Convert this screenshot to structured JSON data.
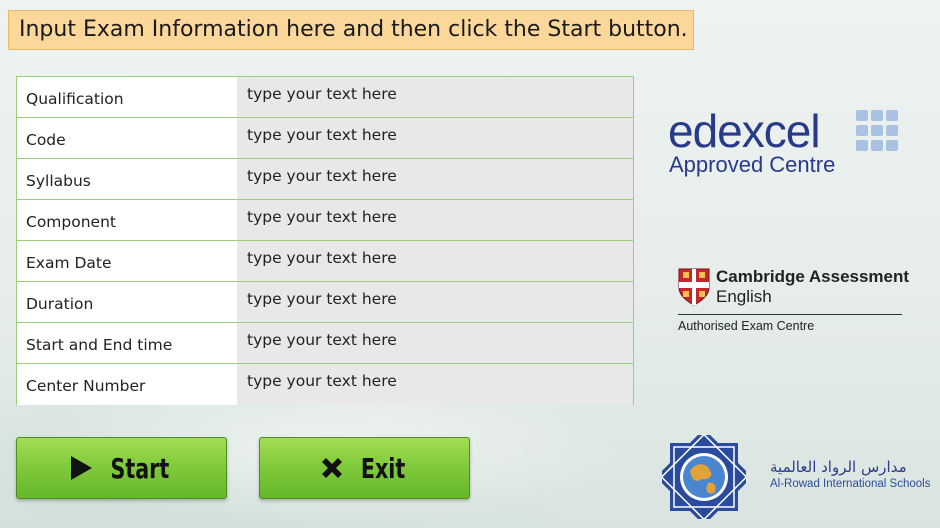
{
  "banner": {
    "text": "Input Exam Information here and then click the Start button."
  },
  "form": {
    "rows": [
      {
        "label": "Qualification",
        "placeholder": "type your text here"
      },
      {
        "label": "Code",
        "placeholder": "type your text here"
      },
      {
        "label": "Syllabus",
        "placeholder": "type your text here"
      },
      {
        "label": "Component",
        "placeholder": "type your text here"
      },
      {
        "label": "Exam Date",
        "placeholder": "type your text here"
      },
      {
        "label": "Duration",
        "placeholder": "type your text here"
      },
      {
        "label": "Start and End time",
        "placeholder": "type your text here"
      },
      {
        "label": "Center Number",
        "placeholder": "type your text here"
      }
    ]
  },
  "buttons": {
    "start": {
      "label": "Start",
      "icon": "play-icon"
    },
    "exit": {
      "label": "Exit",
      "icon": "close-icon"
    }
  },
  "logos": {
    "edexcel": {
      "name": "edexcel",
      "subtitle": "Approved Centre",
      "color": "#283a8a"
    },
    "cambridge": {
      "line1": "Cambridge Assessment",
      "line2": "English",
      "subtitle": "Authorised Exam Centre"
    },
    "rowad": {
      "arabic": "مدارس الرواد العالمية",
      "english": "Al-Rowad International Schools",
      "color": "#2d3d8a"
    }
  }
}
